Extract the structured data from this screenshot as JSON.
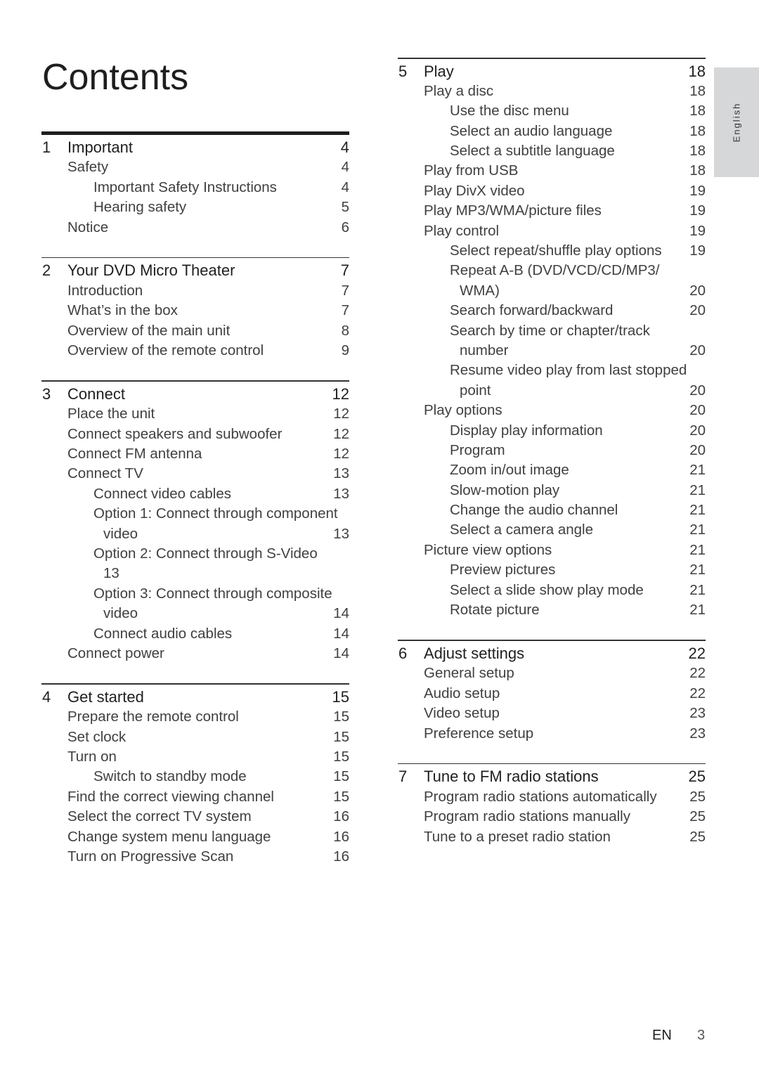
{
  "page": {
    "title": "Contents",
    "language_tab": "English",
    "footer_lang": "EN",
    "page_number": "3"
  },
  "left_column": [
    {
      "num": "1",
      "title": "Important",
      "page": "4",
      "entries": [
        {
          "level": 1,
          "text": "Safety",
          "page": "4"
        },
        {
          "level": 2,
          "text": "Important Safety Instructions",
          "page": "4"
        },
        {
          "level": 2,
          "text": "Hearing safety",
          "page": "5"
        },
        {
          "level": 1,
          "text": "Notice",
          "page": "6"
        }
      ]
    },
    {
      "num": "2",
      "title": "Your DVD Micro Theater",
      "page": "7",
      "entries": [
        {
          "level": 1,
          "text": "Introduction",
          "page": "7"
        },
        {
          "level": 1,
          "text": "What’s in the box",
          "page": "7"
        },
        {
          "level": 1,
          "text": "Overview of the main unit",
          "page": "8"
        },
        {
          "level": 1,
          "text": "Overview of the remote control",
          "page": "9"
        }
      ]
    },
    {
      "num": "3",
      "title": "Connect",
      "page": "12",
      "entries": [
        {
          "level": 1,
          "text": "Place the unit",
          "page": "12"
        },
        {
          "level": 1,
          "text": "Connect speakers and subwoofer",
          "page": "12"
        },
        {
          "level": 1,
          "text": "Connect FM antenna",
          "page": "12"
        },
        {
          "level": 1,
          "text": "Connect TV",
          "page": "13"
        },
        {
          "level": 2,
          "text": "Connect video cables",
          "page": "13"
        },
        {
          "level": 2,
          "text": "Option 1: Connect through component",
          "page": ""
        },
        {
          "level": 3,
          "text": "video",
          "page": "13"
        },
        {
          "level": 2,
          "text": "Option 2: Connect through S-Video",
          "page": ""
        },
        {
          "level": 3,
          "text": "13",
          "page": ""
        },
        {
          "level": 2,
          "text": "Option 3: Connect through composite",
          "page": ""
        },
        {
          "level": 3,
          "text": "video",
          "page": "14"
        },
        {
          "level": 2,
          "text": "Connect audio cables",
          "page": "14"
        },
        {
          "level": 1,
          "text": "Connect power",
          "page": "14"
        }
      ]
    },
    {
      "num": "4",
      "title": "Get started",
      "page": "15",
      "entries": [
        {
          "level": 1,
          "text": "Prepare the remote control",
          "page": "15"
        },
        {
          "level": 1,
          "text": "Set clock",
          "page": "15"
        },
        {
          "level": 1,
          "text": "Turn on",
          "page": "15"
        },
        {
          "level": 2,
          "text": "Switch to standby mode",
          "page": "15"
        },
        {
          "level": 1,
          "text": "Find the correct viewing channel",
          "page": "15"
        },
        {
          "level": 1,
          "text": "Select the correct TV system",
          "page": "16"
        },
        {
          "level": 1,
          "text": "Change system menu language",
          "page": "16"
        },
        {
          "level": 1,
          "text": "Turn on Progressive Scan",
          "page": "16"
        }
      ]
    }
  ],
  "right_column": [
    {
      "num": "5",
      "title": "Play",
      "page": "18",
      "entries": [
        {
          "level": 1,
          "text": "Play a disc",
          "page": "18"
        },
        {
          "level": 2,
          "text": "Use the disc menu",
          "page": "18"
        },
        {
          "level": 2,
          "text": "Select an audio language",
          "page": "18"
        },
        {
          "level": 2,
          "text": "Select a subtitle language",
          "page": "18"
        },
        {
          "level": 1,
          "text": "Play from USB",
          "page": "18"
        },
        {
          "level": 1,
          "text": "Play DivX video",
          "page": "19"
        },
        {
          "level": 1,
          "text": "Play MP3/WMA/picture files",
          "page": "19"
        },
        {
          "level": 1,
          "text": "Play control",
          "page": "19"
        },
        {
          "level": 2,
          "text": "Select repeat/shuffle play options",
          "page": "19"
        },
        {
          "level": 2,
          "text": "Repeat A-B (DVD/VCD/CD/MP3/",
          "page": ""
        },
        {
          "level": 3,
          "text": "WMA)",
          "page": "20"
        },
        {
          "level": 2,
          "text": "Search forward/backward",
          "page": "20"
        },
        {
          "level": 2,
          "text": "Search by time or chapter/track",
          "page": ""
        },
        {
          "level": 3,
          "text": "number",
          "page": "20"
        },
        {
          "level": 2,
          "text": "Resume video play from last stopped",
          "page": ""
        },
        {
          "level": 3,
          "text": "point",
          "page": "20"
        },
        {
          "level": 1,
          "text": "Play options",
          "page": "20"
        },
        {
          "level": 2,
          "text": "Display play information",
          "page": "20"
        },
        {
          "level": 2,
          "text": "Program",
          "page": "20"
        },
        {
          "level": 2,
          "text": "Zoom in/out image",
          "page": "21"
        },
        {
          "level": 2,
          "text": "Slow-motion play",
          "page": "21"
        },
        {
          "level": 2,
          "text": "Change the audio channel",
          "page": "21"
        },
        {
          "level": 2,
          "text": "Select a camera angle",
          "page": "21"
        },
        {
          "level": 1,
          "text": "Picture view options",
          "page": "21"
        },
        {
          "level": 2,
          "text": "Preview pictures",
          "page": "21"
        },
        {
          "level": 2,
          "text": "Select a slide show play mode",
          "page": "21"
        },
        {
          "level": 2,
          "text": "Rotate picture",
          "page": "21"
        }
      ]
    },
    {
      "num": "6",
      "title": "Adjust settings",
      "page": "22",
      "entries": [
        {
          "level": 1,
          "text": "General setup",
          "page": "22"
        },
        {
          "level": 1,
          "text": "Audio setup",
          "page": "22"
        },
        {
          "level": 1,
          "text": "Video setup",
          "page": "23"
        },
        {
          "level": 1,
          "text": "Preference setup",
          "page": "23"
        }
      ]
    },
    {
      "num": "7",
      "title": "Tune to FM radio stations",
      "page": "25",
      "entries": [
        {
          "level": 1,
          "text": "Program radio stations automatically",
          "page": "25"
        },
        {
          "level": 1,
          "text": "Program radio stations manually",
          "page": "25"
        },
        {
          "level": 1,
          "text": "Tune to a preset radio station",
          "page": "25"
        }
      ]
    }
  ]
}
